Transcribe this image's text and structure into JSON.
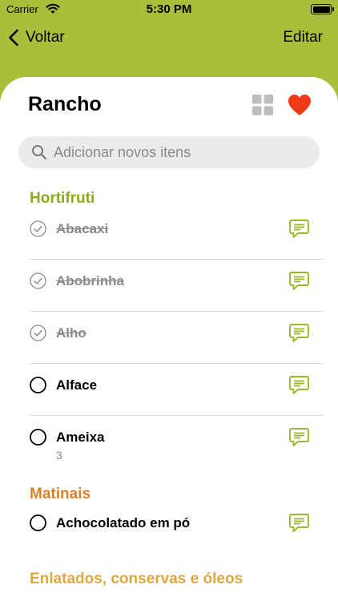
{
  "status_bar": {
    "carrier": "Carrier",
    "time": "5:30 PM"
  },
  "nav": {
    "back_label": "Voltar",
    "edit_label": "Editar"
  },
  "list": {
    "title": "Rancho"
  },
  "search": {
    "placeholder": "Adicionar novos itens",
    "value": ""
  },
  "colors": {
    "accent": "#a8bf3c",
    "hortifruti": "#8aab1f",
    "matinais": "#d9812a",
    "enlatados": "#e0a83a",
    "heart": "#f03a17"
  },
  "sections": [
    {
      "name": "Hortifruti",
      "items": [
        {
          "name": "Abacaxi",
          "checked": true,
          "quantity": ""
        },
        {
          "name": "Abobrinha",
          "checked": true,
          "quantity": ""
        },
        {
          "name": "Alho",
          "checked": true,
          "quantity": ""
        },
        {
          "name": "Alface",
          "checked": false,
          "quantity": ""
        },
        {
          "name": "Ameixa",
          "checked": false,
          "quantity": "3"
        }
      ]
    },
    {
      "name": "Matinais",
      "items": [
        {
          "name": "Achocolatado em pó",
          "checked": false,
          "quantity": ""
        }
      ]
    },
    {
      "name": "Enlatados, conservas e óleos",
      "items": []
    }
  ],
  "icons": {
    "back": "chevron-left-icon",
    "grid": "grid-icon",
    "favorite": "heart-icon",
    "search": "search-icon",
    "note": "note-icon"
  }
}
